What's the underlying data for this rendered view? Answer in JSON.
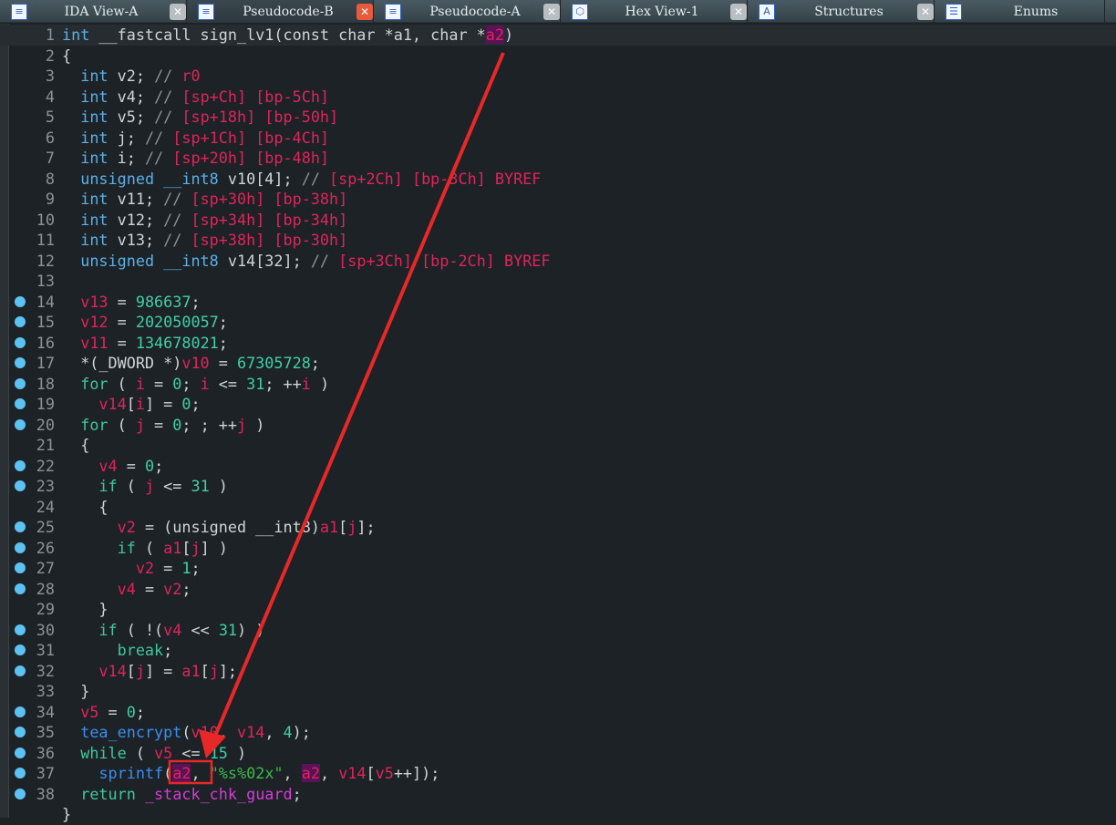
{
  "tabs": [
    {
      "label": "IDA View-A",
      "icon": "disassembly-icon",
      "glyph": "≡",
      "active": false
    },
    {
      "label": "Pseudocode-B",
      "icon": "pseudocode-icon",
      "glyph": "≡",
      "active": true
    },
    {
      "label": "Pseudocode-A",
      "icon": "pseudocode-icon",
      "glyph": "≡",
      "active": false
    },
    {
      "label": "Hex View-1",
      "icon": "hex-icon",
      "glyph": "⬡",
      "active": false
    },
    {
      "label": "Structures",
      "icon": "structures-icon",
      "glyph": "A",
      "active": false
    },
    {
      "label": "Enums",
      "icon": "enums-icon",
      "glyph": "☰",
      "active": false
    }
  ],
  "close_glyph": "✕",
  "colors": {
    "annotation": "#e82828",
    "highlight": "#5a1258"
  },
  "code": [
    {
      "n": "1",
      "dot": false,
      "s": [
        [
          "kw",
          "int"
        ],
        [
          "p",
          " __fastcall sign_lv1(const char *a1, char *"
        ],
        [
          "hl",
          "a2"
        ],
        [
          "p",
          ")"
        ]
      ]
    },
    {
      "n": "2",
      "dot": false,
      "s": [
        [
          "p",
          "{"
        ]
      ]
    },
    {
      "n": "3",
      "dot": false,
      "s": [
        [
          "p",
          "  "
        ],
        [
          "kw",
          "int"
        ],
        [
          "p",
          " v2; "
        ],
        [
          "cm",
          "// "
        ],
        [
          "var",
          "r0"
        ]
      ]
    },
    {
      "n": "4",
      "dot": false,
      "s": [
        [
          "p",
          "  "
        ],
        [
          "kw",
          "int"
        ],
        [
          "p",
          " v4; "
        ],
        [
          "cm",
          "// "
        ],
        [
          "var",
          "[sp+Ch] [bp-5Ch]"
        ]
      ]
    },
    {
      "n": "5",
      "dot": false,
      "s": [
        [
          "p",
          "  "
        ],
        [
          "kw",
          "int"
        ],
        [
          "p",
          " v5; "
        ],
        [
          "cm",
          "// "
        ],
        [
          "var",
          "[sp+18h] [bp-50h]"
        ]
      ]
    },
    {
      "n": "6",
      "dot": false,
      "s": [
        [
          "p",
          "  "
        ],
        [
          "kw",
          "int"
        ],
        [
          "p",
          " j; "
        ],
        [
          "cm",
          "// "
        ],
        [
          "var",
          "[sp+1Ch] [bp-4Ch]"
        ]
      ]
    },
    {
      "n": "7",
      "dot": false,
      "s": [
        [
          "p",
          "  "
        ],
        [
          "kw",
          "int"
        ],
        [
          "p",
          " i; "
        ],
        [
          "cm",
          "// "
        ],
        [
          "var",
          "[sp+20h] [bp-48h]"
        ]
      ]
    },
    {
      "n": "8",
      "dot": false,
      "s": [
        [
          "p",
          "  "
        ],
        [
          "kw",
          "unsigned __int8"
        ],
        [
          "p",
          " v10[4]; "
        ],
        [
          "cm",
          "// "
        ],
        [
          "var",
          "[sp+2Ch] [bp-3Ch] BYREF"
        ]
      ]
    },
    {
      "n": "9",
      "dot": false,
      "s": [
        [
          "p",
          "  "
        ],
        [
          "kw",
          "int"
        ],
        [
          "p",
          " v11; "
        ],
        [
          "cm",
          "// "
        ],
        [
          "var",
          "[sp+30h] [bp-38h]"
        ]
      ]
    },
    {
      "n": "10",
      "dot": false,
      "s": [
        [
          "p",
          "  "
        ],
        [
          "kw",
          "int"
        ],
        [
          "p",
          " v12; "
        ],
        [
          "cm",
          "// "
        ],
        [
          "var",
          "[sp+34h] [bp-34h]"
        ]
      ]
    },
    {
      "n": "11",
      "dot": false,
      "s": [
        [
          "p",
          "  "
        ],
        [
          "kw",
          "int"
        ],
        [
          "p",
          " v13; "
        ],
        [
          "cm",
          "// "
        ],
        [
          "var",
          "[sp+38h] [bp-30h]"
        ]
      ]
    },
    {
      "n": "12",
      "dot": false,
      "s": [
        [
          "p",
          "  "
        ],
        [
          "kw",
          "unsigned __int8"
        ],
        [
          "p",
          " v14[32]; "
        ],
        [
          "cm",
          "// "
        ],
        [
          "var",
          "[sp+3Ch] [bp-2Ch] BYREF"
        ]
      ]
    },
    {
      "n": "13",
      "dot": false,
      "s": []
    },
    {
      "n": "14",
      "dot": true,
      "s": [
        [
          "p",
          "  "
        ],
        [
          "var",
          "v13"
        ],
        [
          "p",
          " = "
        ],
        [
          "num",
          "986637"
        ],
        [
          "p",
          ";"
        ]
      ]
    },
    {
      "n": "15",
      "dot": true,
      "s": [
        [
          "p",
          "  "
        ],
        [
          "var",
          "v12"
        ],
        [
          "p",
          " = "
        ],
        [
          "num",
          "202050057"
        ],
        [
          "p",
          ";"
        ]
      ]
    },
    {
      "n": "16",
      "dot": true,
      "s": [
        [
          "p",
          "  "
        ],
        [
          "var",
          "v11"
        ],
        [
          "p",
          " = "
        ],
        [
          "num",
          "134678021"
        ],
        [
          "p",
          ";"
        ]
      ]
    },
    {
      "n": "17",
      "dot": true,
      "s": [
        [
          "p",
          "  *(_DWORD *)"
        ],
        [
          "var",
          "v10"
        ],
        [
          "p",
          " = "
        ],
        [
          "num",
          "67305728"
        ],
        [
          "p",
          ";"
        ]
      ]
    },
    {
      "n": "18",
      "dot": true,
      "s": [
        [
          "p",
          "  "
        ],
        [
          "ctl",
          "for"
        ],
        [
          "p",
          " ( "
        ],
        [
          "var",
          "i"
        ],
        [
          "p",
          " = "
        ],
        [
          "num",
          "0"
        ],
        [
          "p",
          "; "
        ],
        [
          "var",
          "i"
        ],
        [
          "p",
          " <= "
        ],
        [
          "num",
          "31"
        ],
        [
          "p",
          "; ++"
        ],
        [
          "var",
          "i"
        ],
        [
          "p",
          " )"
        ]
      ]
    },
    {
      "n": "19",
      "dot": true,
      "s": [
        [
          "p",
          "    "
        ],
        [
          "var",
          "v14"
        ],
        [
          "p",
          "["
        ],
        [
          "var",
          "i"
        ],
        [
          "p",
          "] = "
        ],
        [
          "num",
          "0"
        ],
        [
          "p",
          ";"
        ]
      ]
    },
    {
      "n": "20",
      "dot": true,
      "s": [
        [
          "p",
          "  "
        ],
        [
          "ctl",
          "for"
        ],
        [
          "p",
          " ( "
        ],
        [
          "var",
          "j"
        ],
        [
          "p",
          " = "
        ],
        [
          "num",
          "0"
        ],
        [
          "p",
          "; ; ++"
        ],
        [
          "var",
          "j"
        ],
        [
          "p",
          " )"
        ]
      ]
    },
    {
      "n": "21",
      "dot": false,
      "s": [
        [
          "p",
          "  {"
        ]
      ]
    },
    {
      "n": "22",
      "dot": true,
      "s": [
        [
          "p",
          "    "
        ],
        [
          "var",
          "v4"
        ],
        [
          "p",
          " = "
        ],
        [
          "num",
          "0"
        ],
        [
          "p",
          ";"
        ]
      ]
    },
    {
      "n": "23",
      "dot": true,
      "s": [
        [
          "p",
          "    "
        ],
        [
          "ctl",
          "if"
        ],
        [
          "p",
          " ( "
        ],
        [
          "var",
          "j"
        ],
        [
          "p",
          " <= "
        ],
        [
          "num",
          "31"
        ],
        [
          "p",
          " )"
        ]
      ]
    },
    {
      "n": "24",
      "dot": false,
      "s": [
        [
          "p",
          "    {"
        ]
      ]
    },
    {
      "n": "25",
      "dot": true,
      "s": [
        [
          "p",
          "      "
        ],
        [
          "var",
          "v2"
        ],
        [
          "p",
          " = (unsigned __int8)"
        ],
        [
          "var",
          "a1"
        ],
        [
          "p",
          "["
        ],
        [
          "var",
          "j"
        ],
        [
          "p",
          "];"
        ]
      ]
    },
    {
      "n": "26",
      "dot": true,
      "s": [
        [
          "p",
          "      "
        ],
        [
          "ctl",
          "if"
        ],
        [
          "p",
          " ( "
        ],
        [
          "var",
          "a1"
        ],
        [
          "p",
          "["
        ],
        [
          "var",
          "j"
        ],
        [
          "p",
          "] )"
        ]
      ]
    },
    {
      "n": "27",
      "dot": true,
      "s": [
        [
          "p",
          "        "
        ],
        [
          "var",
          "v2"
        ],
        [
          "p",
          " = "
        ],
        [
          "num",
          "1"
        ],
        [
          "p",
          ";"
        ]
      ]
    },
    {
      "n": "28",
      "dot": true,
      "s": [
        [
          "p",
          "      "
        ],
        [
          "var",
          "v4"
        ],
        [
          "p",
          " = "
        ],
        [
          "var",
          "v2"
        ],
        [
          "p",
          ";"
        ]
      ]
    },
    {
      "n": "29",
      "dot": false,
      "s": [
        [
          "p",
          "    }"
        ]
      ]
    },
    {
      "n": "30",
      "dot": true,
      "s": [
        [
          "p",
          "    "
        ],
        [
          "ctl",
          "if"
        ],
        [
          "p",
          " ( !("
        ],
        [
          "var",
          "v4"
        ],
        [
          "p",
          " << "
        ],
        [
          "num",
          "31"
        ],
        [
          "p",
          ") )"
        ]
      ]
    },
    {
      "n": "31",
      "dot": true,
      "s": [
        [
          "p",
          "      "
        ],
        [
          "ctl",
          "break"
        ],
        [
          "p",
          ";"
        ]
      ]
    },
    {
      "n": "32",
      "dot": true,
      "s": [
        [
          "p",
          "    "
        ],
        [
          "var",
          "v14"
        ],
        [
          "p",
          "["
        ],
        [
          "var",
          "j"
        ],
        [
          "p",
          "] = "
        ],
        [
          "var",
          "a1"
        ],
        [
          "p",
          "["
        ],
        [
          "var",
          "j"
        ],
        [
          "p",
          "];"
        ]
      ]
    },
    {
      "n": "33",
      "dot": false,
      "s": [
        [
          "p",
          "  }"
        ]
      ]
    },
    {
      "n": "34",
      "dot": true,
      "s": [
        [
          "p",
          "  "
        ],
        [
          "var",
          "v5"
        ],
        [
          "p",
          " = "
        ],
        [
          "num",
          "0"
        ],
        [
          "p",
          ";"
        ]
      ]
    },
    {
      "n": "35",
      "dot": true,
      "s": [
        [
          "p",
          "  "
        ],
        [
          "fn",
          "tea_encrypt"
        ],
        [
          "p",
          "("
        ],
        [
          "var",
          "v10"
        ],
        [
          "p",
          ", "
        ],
        [
          "var",
          "v14"
        ],
        [
          "p",
          ", "
        ],
        [
          "num",
          "4"
        ],
        [
          "p",
          ");"
        ]
      ]
    },
    {
      "n": "36",
      "dot": true,
      "s": [
        [
          "p",
          "  "
        ],
        [
          "ctl",
          "while"
        ],
        [
          "p",
          " ( "
        ],
        [
          "var",
          "v5"
        ],
        [
          "p",
          " <= "
        ],
        [
          "num",
          "15"
        ],
        [
          "p",
          " )"
        ]
      ]
    },
    {
      "n": "37",
      "dot": true,
      "s": [
        [
          "p",
          "    "
        ],
        [
          "fn",
          "sprintf"
        ],
        [
          "p",
          "("
        ],
        [
          "hl",
          "a2"
        ],
        [
          "p",
          ", "
        ],
        [
          "str",
          "\"%s%02x\""
        ],
        [
          "p",
          ", "
        ],
        [
          "hl",
          "a2"
        ],
        [
          "p",
          ", "
        ],
        [
          "var",
          "v14"
        ],
        [
          "p",
          "["
        ],
        [
          "var",
          "v5"
        ],
        [
          "p",
          "++]);"
        ]
      ]
    },
    {
      "n": "38",
      "dot": true,
      "s": [
        [
          "p",
          "  "
        ],
        [
          "ctl",
          "return"
        ],
        [
          "p",
          " "
        ],
        [
          "gl",
          "_stack_chk_guard"
        ],
        [
          "p",
          ";"
        ]
      ]
    },
    {
      "n": "",
      "dot": false,
      "s": [
        [
          "p",
          "}"
        ]
      ]
    }
  ]
}
